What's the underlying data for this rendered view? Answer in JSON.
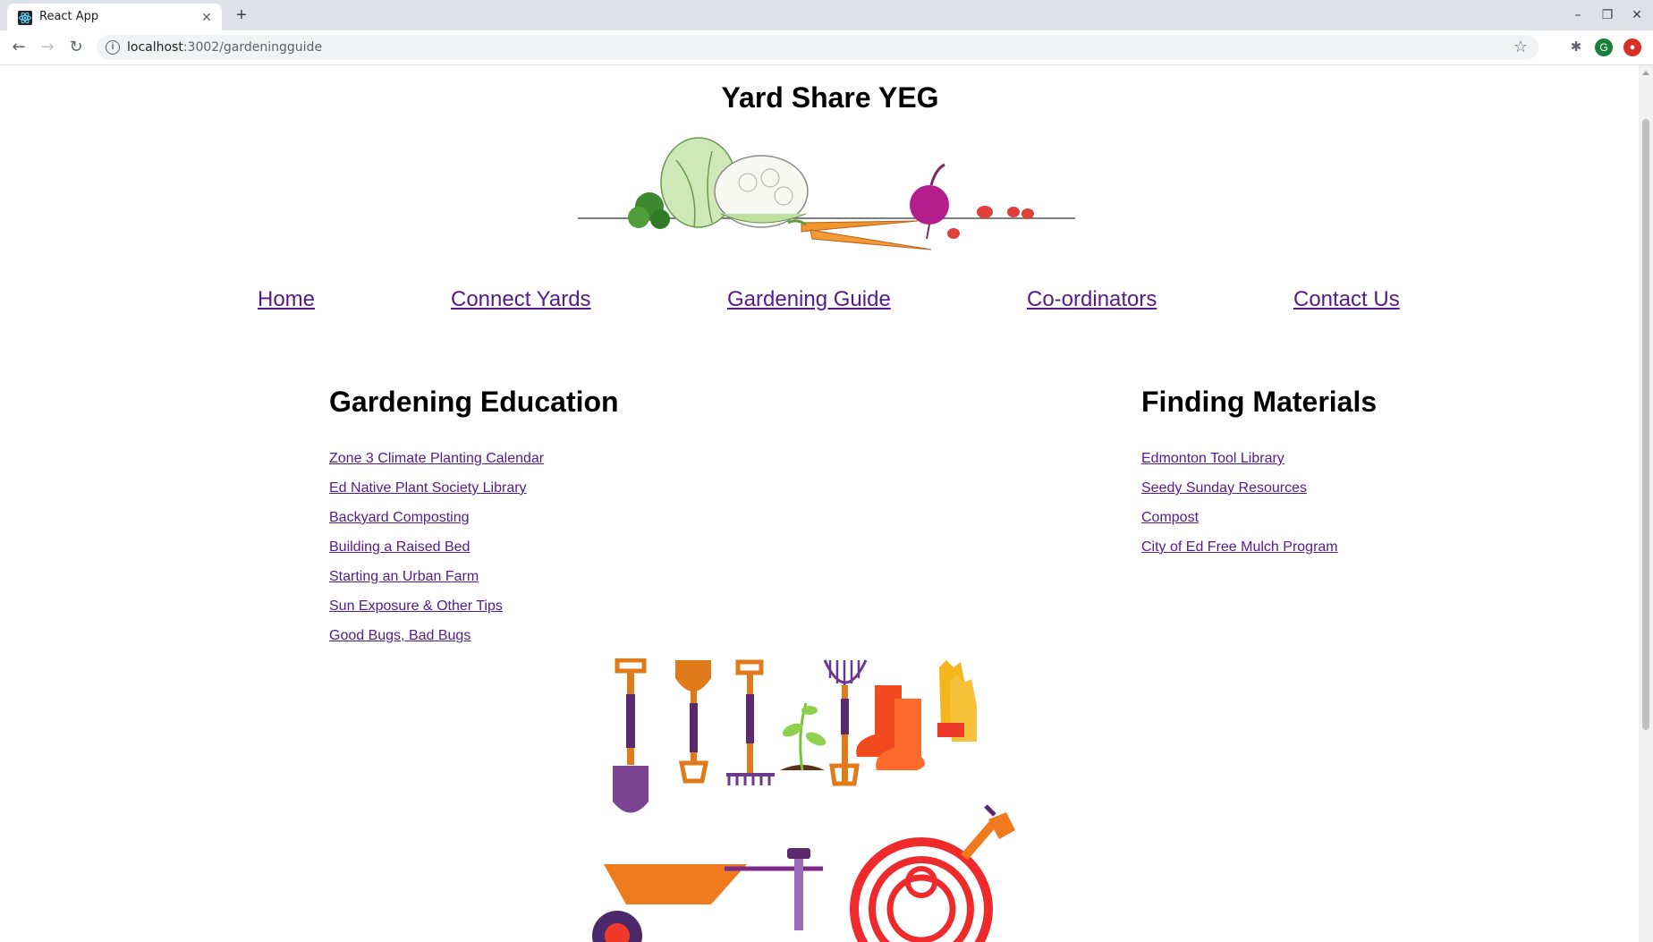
{
  "browser": {
    "tab_title": "React App",
    "url_host": "localhost",
    "url_path": ":3002/gardeningguide",
    "profile_initial": "G"
  },
  "page": {
    "site_title": "Yard Share YEG",
    "nav": [
      {
        "label": "Home"
      },
      {
        "label": "Connect Yards"
      },
      {
        "label": "Gardening Guide"
      },
      {
        "label": "Co-ordinators"
      },
      {
        "label": "Contact Us"
      }
    ],
    "education": {
      "title": "Gardening Education",
      "links": [
        "Zone 3 Climate Planting Calendar",
        "Ed Native Plant Society Library",
        "Backyard Composting",
        "Building a Raised Bed",
        "Starting an Urban Farm",
        "Sun Exposure & Other Tips",
        "Good Bugs, Bad Bugs"
      ]
    },
    "materials": {
      "title": "Finding Materials",
      "links": [
        "Edmonton Tool Library",
        "Seedy Sunday Resources",
        "Compost",
        "City of Ed Free Mulch Program"
      ]
    }
  },
  "colors": {
    "visited_link": "#551a8b",
    "tab_strip": "#dee1e6"
  }
}
